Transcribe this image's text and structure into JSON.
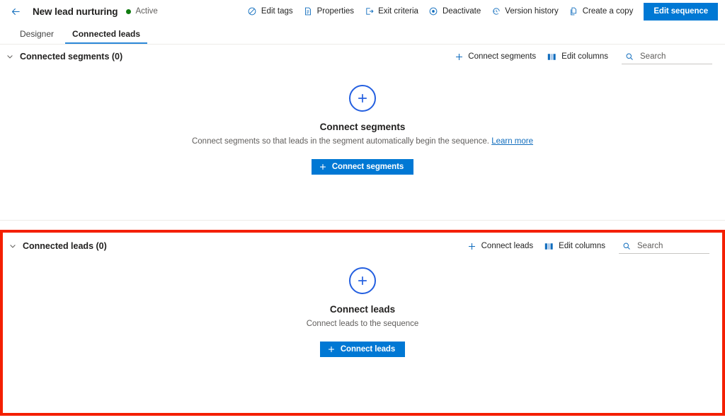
{
  "header": {
    "back_icon": "back-arrow-icon",
    "title": "New lead nurturing",
    "status": "Active",
    "status_color": "#107c10",
    "commands": [
      {
        "label": "Edit tags",
        "icon": "tag-icon"
      },
      {
        "label": "Properties",
        "icon": "document-properties-icon"
      },
      {
        "label": "Exit criteria",
        "icon": "exit-icon"
      },
      {
        "label": "Deactivate",
        "icon": "deactivate-circle-icon"
      },
      {
        "label": "Version history",
        "icon": "history-clock-icon"
      },
      {
        "label": "Create a copy",
        "icon": "copy-icon"
      }
    ],
    "primary_button": "Edit sequence",
    "primary_color": "#0078d4"
  },
  "tabs": [
    {
      "label": "Designer",
      "active": false
    },
    {
      "label": "Connected leads",
      "active": true
    }
  ],
  "segments_section": {
    "chevron_icon": "chevron-down-icon",
    "title": "Connected segments (0)",
    "tools": [
      {
        "label": "Connect segments",
        "icon": "plus-icon"
      },
      {
        "label": "Edit columns",
        "icon": "columns-icon"
      }
    ],
    "search_placeholder": "Search",
    "search_value": "",
    "search_icon": "search-icon",
    "empty": {
      "icon": "circle-plus-icon",
      "title": "Connect segments",
      "description": "Connect segments so that leads in the segment automatically begin the sequence.",
      "link": "Learn more",
      "button": "Connect segments"
    }
  },
  "leads_section": {
    "chevron_icon": "chevron-down-icon",
    "title": "Connected leads (0)",
    "tools": [
      {
        "label": "Connect leads",
        "icon": "plus-icon"
      },
      {
        "label": "Edit columns",
        "icon": "columns-icon"
      }
    ],
    "search_placeholder": "Search",
    "search_value": "",
    "search_icon": "search-icon",
    "empty": {
      "icon": "circle-plus-icon",
      "title": "Connect leads",
      "description": "Connect leads to the sequence",
      "button": "Connect leads"
    },
    "highlight_color": "#f41f00"
  }
}
